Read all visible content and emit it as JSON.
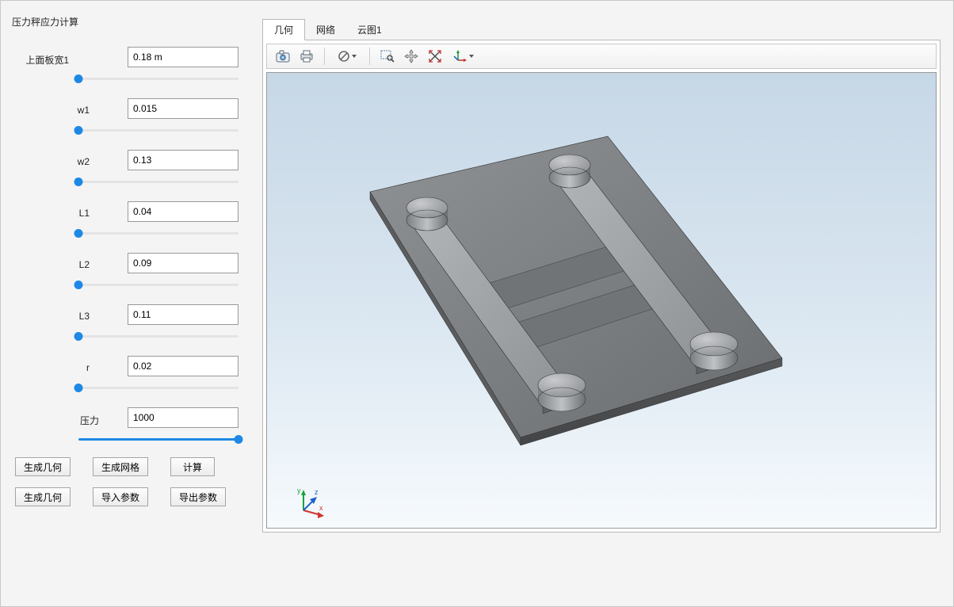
{
  "panel": {
    "title": "压力秤应力计算"
  },
  "params": [
    {
      "label": "上面板宽1",
      "value": "0.18 m",
      "slider_pct": 0
    },
    {
      "label": "w1",
      "value": "0.015",
      "slider_pct": 0
    },
    {
      "label": "w2",
      "value": "0.13",
      "slider_pct": 0
    },
    {
      "label": "L1",
      "value": "0.04",
      "slider_pct": 0
    },
    {
      "label": "L2",
      "value": "0.09",
      "slider_pct": 0
    },
    {
      "label": "L3",
      "value": "0.11",
      "slider_pct": 0
    },
    {
      "label": "r",
      "value": "0.02",
      "slider_pct": 0
    },
    {
      "label": "压力",
      "value": "1000",
      "slider_pct": 100
    }
  ],
  "buttons_row1": [
    "生成几何",
    "生成网格",
    "计算"
  ],
  "buttons_row2": [
    "生成几何",
    "导入参数",
    "导出参数"
  ],
  "tabs": [
    "几何",
    "网络",
    "云图1"
  ],
  "active_tab": 0,
  "toolbar_icons": {
    "snapshot": "camera-icon",
    "print": "print-icon",
    "nosymbol": "no-symbol-icon",
    "zoombox": "zoom-box-icon",
    "pan": "pan-icon",
    "fit": "zoom-extents-icon",
    "axes": "axes-icon"
  },
  "triad_labels": {
    "x": "x",
    "y": "y",
    "z": "z"
  }
}
